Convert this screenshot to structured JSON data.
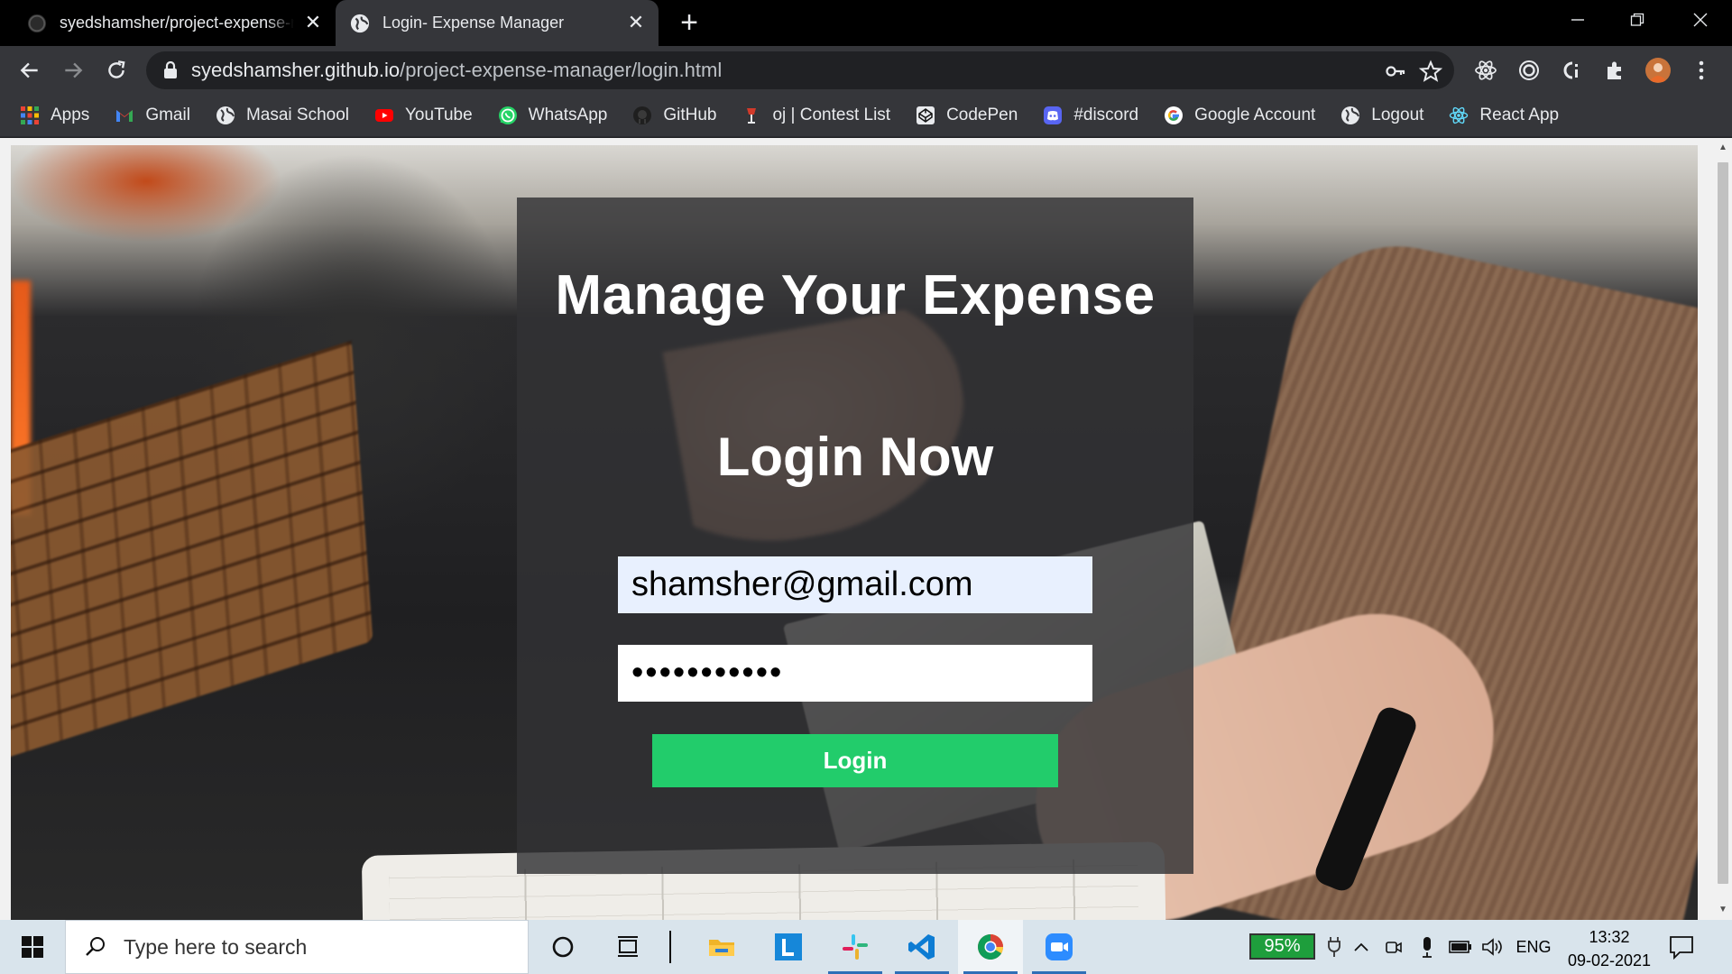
{
  "browser": {
    "tabs": [
      {
        "title": "syedshamsher/project-expense-manager",
        "active": false
      },
      {
        "title": "Login- Expense Manager",
        "active": true
      }
    ],
    "url": {
      "host": "syedshamsher.github.io",
      "path": "/project-expense-manager/login.html"
    },
    "bookmarks": [
      {
        "label": "Apps",
        "icon": "apps-grid-icon"
      },
      {
        "label": "Gmail",
        "icon": "gmail-icon"
      },
      {
        "label": "Masai School",
        "icon": "globe-icon"
      },
      {
        "label": "YouTube",
        "icon": "youtube-icon"
      },
      {
        "label": "WhatsApp",
        "icon": "whatsapp-icon"
      },
      {
        "label": "GitHub",
        "icon": "github-icon"
      },
      {
        "label": "oj | Contest List",
        "icon": "oj-icon"
      },
      {
        "label": "CodePen",
        "icon": "codepen-icon"
      },
      {
        "label": "#discord",
        "icon": "discord-icon"
      },
      {
        "label": "Google Account",
        "icon": "google-icon"
      },
      {
        "label": "Logout",
        "icon": "globe-icon"
      },
      {
        "label": "React App",
        "icon": "react-icon"
      }
    ]
  },
  "page": {
    "heading": "Manage Your Expense",
    "subheading": "Login Now",
    "email_value": "shamsher@gmail.com",
    "password_value": "•••••••••••",
    "login_label": "Login",
    "accent_color": "#22cc6b"
  },
  "taskbar": {
    "search_placeholder": "Type here to search",
    "battery": "95%",
    "language": "ENG",
    "time": "13:32",
    "date": "09-02-2021"
  }
}
